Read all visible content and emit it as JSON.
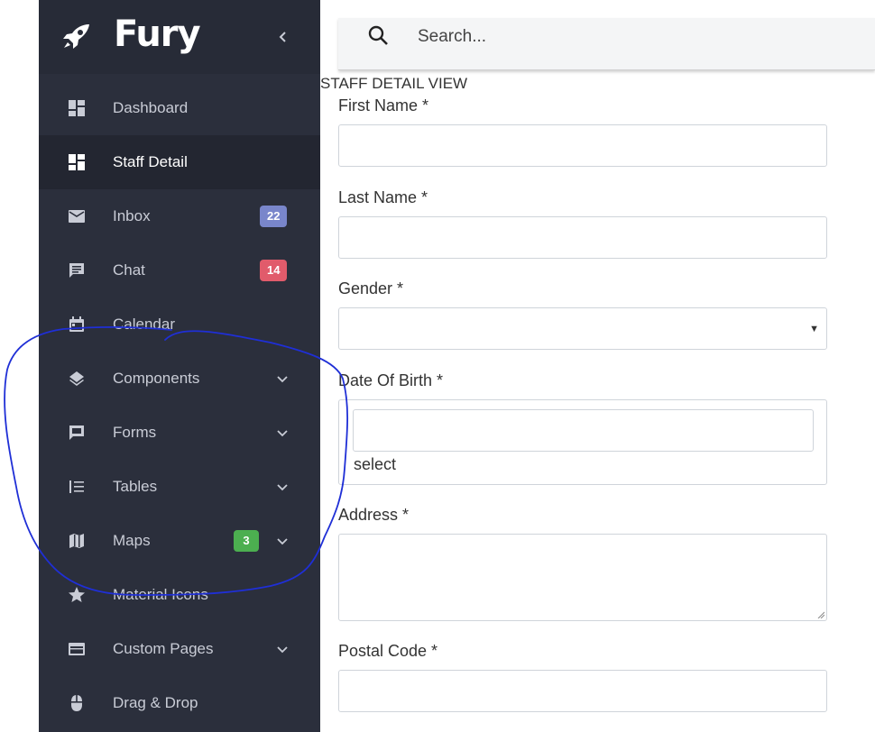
{
  "app": {
    "name": "Fury"
  },
  "search": {
    "placeholder": "Search..."
  },
  "sidebar": {
    "items": [
      {
        "label": "Dashboard",
        "icon": "dashboard-icon",
        "active": false
      },
      {
        "label": "Staff Detail",
        "icon": "dashboard-icon",
        "active": true
      },
      {
        "label": "Inbox",
        "icon": "mail-icon",
        "badge": "22",
        "badge_color": "#7986cb"
      },
      {
        "label": "Chat",
        "icon": "chat-icon",
        "badge": "14",
        "badge_color": "#e15b6b"
      },
      {
        "label": "Calendar",
        "icon": "calendar-icon"
      },
      {
        "label": "Components",
        "icon": "layers-icon",
        "expandable": true
      },
      {
        "label": "Forms",
        "icon": "forms-icon",
        "expandable": true
      },
      {
        "label": "Tables",
        "icon": "tables-icon",
        "expandable": true
      },
      {
        "label": "Maps",
        "icon": "map-icon",
        "badge": "3",
        "badge_color": "#4caf50",
        "expandable": true
      },
      {
        "label": "Material Icons",
        "icon": "star-icon"
      },
      {
        "label": "Custom Pages",
        "icon": "web-icon",
        "expandable": true
      },
      {
        "label": "Drag & Drop",
        "icon": "mouse-icon"
      }
    ]
  },
  "form": {
    "title": "STAFF DETAIL VIEW",
    "first_name_label": "First Name *",
    "last_name_label": "Last Name *",
    "gender_label": "Gender *",
    "dob_label": "Date Of Birth *",
    "dob_select_text": "select",
    "address_label": "Address *",
    "postal_code_label": "Postal Code *"
  },
  "colors": {
    "sidebar_bg": "#2b2f3c",
    "sidebar_active": "#232631",
    "annotation_stroke": "#1f2fd6"
  }
}
